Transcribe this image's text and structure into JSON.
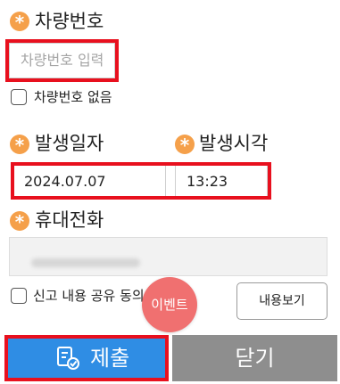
{
  "vehicle": {
    "label": "차량번호",
    "placeholder": "차량번호 입력",
    "no_plate_label": "차량번호 없음"
  },
  "occurrence": {
    "date_label": "발생일자",
    "time_label": "발생시각",
    "date_value": "2024.07.07",
    "time_value": "13:23"
  },
  "phone": {
    "label": "휴대전화"
  },
  "consent": {
    "label": "신고 내용 공유 동의",
    "view_button": "내용보기"
  },
  "event_badge": "이벤트",
  "actions": {
    "submit": "제출",
    "close": "닫기"
  },
  "colors": {
    "required_marker": "#f5a04a",
    "highlight": "#e8101e",
    "submit_bg": "#2f8de4",
    "close_bg": "#8e8e8e",
    "event_bg": "#f07070"
  }
}
